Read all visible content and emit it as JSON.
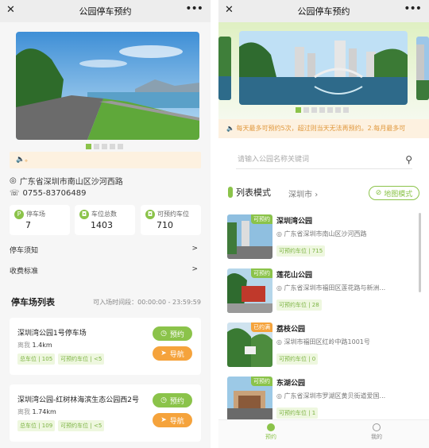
{
  "left": {
    "nav_title": "公园停车预约",
    "notice": "。",
    "address": "广东省深圳市南山区沙河西路",
    "phone": "0755-83706489",
    "stats": [
      {
        "label": "停车场",
        "value": "7",
        "icon": "P"
      },
      {
        "label": "车位总数",
        "value": "1403",
        "icon": "car-icon"
      },
      {
        "label": "可预约车位",
        "value": "710",
        "icon": "car-icon"
      }
    ],
    "links": [
      {
        "label": "停车须知",
        "arrow": ">"
      },
      {
        "label": "收费标准",
        "arrow": ">"
      }
    ],
    "section_title": "停车场列表",
    "entry_time": "可入场时间段：00:00:00 - 23:59:59",
    "lots": [
      {
        "name": "深圳湾公园1号停车场",
        "dist_label": "离我",
        "dist": "1.4km",
        "total": "总车位 | 105",
        "avail": "可预约车位 | <5",
        "book": "预约",
        "nav": "导航"
      },
      {
        "name": "深圳湾公园-红树林海滨生态公园西2号",
        "dist_label": "离我",
        "dist": "1.74km",
        "total": "总车位 | 109",
        "avail": "可预约车位 | <5",
        "book": "预约",
        "nav": "导航"
      }
    ]
  },
  "right": {
    "nav_title": "公园停车预约",
    "notice": "每天最多可预约5次，超过则当天无法再预约。2.每月最多可",
    "search_placeholder": "请输入公园名称关键词",
    "mode_title": "列表模式",
    "city": "深圳市",
    "map_mode": "地图模式",
    "parks": [
      {
        "name": "深圳湾公园",
        "address": "广东省深圳市南山区沙河西路",
        "badge": "可预约",
        "badge_color": "#8bc34a",
        "avail": "可预约车位 | 715"
      },
      {
        "name": "莲花山公园",
        "address": "广东省深圳市福田区莲花路与新洲...",
        "badge": "可预约",
        "badge_color": "#8bc34a",
        "avail": "可预约车位 | 28"
      },
      {
        "name": "荔枝公园",
        "address": "深圳市福田区红岭中路1001号",
        "badge": "已约满",
        "badge_color": "#f5a33c",
        "avail": "可预约车位 | 0"
      },
      {
        "name": "东湖公园",
        "address": "广东省深圳市罗湖区黄贝街道爱国...",
        "badge": "可预约",
        "badge_color": "#8bc34a",
        "avail": "可预约车位 | 1"
      }
    ],
    "tabs": [
      {
        "label": "预约",
        "active": true
      },
      {
        "label": "我的",
        "active": false
      }
    ]
  },
  "colors": {
    "accent": "#8bc34a",
    "orange": "#f5a33c",
    "notice_bg": "#fdf1e0"
  }
}
